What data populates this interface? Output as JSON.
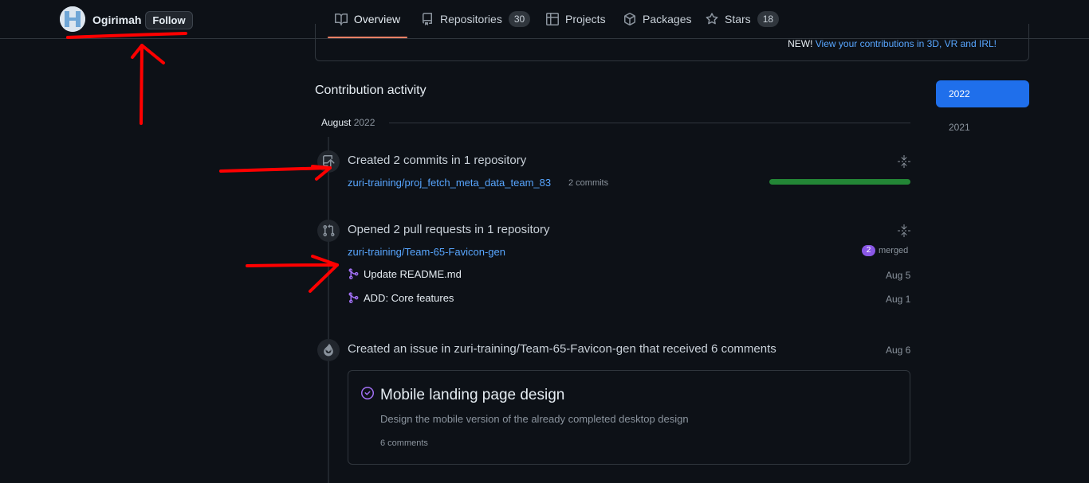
{
  "profile": {
    "username": "Ogirimah",
    "follow_label": "Follow"
  },
  "nav": {
    "tabs": [
      {
        "label": "Overview",
        "icon": "book-icon",
        "active": true
      },
      {
        "label": "Repositories",
        "icon": "repo-icon",
        "count": "30"
      },
      {
        "label": "Projects",
        "icon": "table-icon"
      },
      {
        "label": "Packages",
        "icon": "package-icon"
      },
      {
        "label": "Stars",
        "icon": "star-icon",
        "count": "18"
      }
    ]
  },
  "banner": {
    "new_label": "NEW!",
    "link_text": "View your contributions in 3D, VR and IRL!"
  },
  "activity": {
    "title": "Contribution activity",
    "month": "August",
    "year": "2022"
  },
  "years": {
    "active": "2022",
    "other": "2021"
  },
  "events": {
    "commits": {
      "title": "Created 2 commits in 1 repository",
      "repo": "zuri-training/proj_fetch_meta_data_team_83",
      "count_label": "2 commits",
      "progress": 1.0
    },
    "pulls": {
      "title": "Opened 2 pull requests in 1 repository",
      "repo": "zuri-training/Team-65-Favicon-gen",
      "merged_count": "2",
      "merged_label": "merged",
      "items": [
        {
          "title": "Update README.md",
          "date": "Aug 5"
        },
        {
          "title": "ADD: Core features",
          "date": "Aug 1"
        }
      ]
    },
    "issue": {
      "title": "Created an issue in zuri-training/Team-65-Favicon-gen that received 6 comments",
      "date": "Aug 6",
      "card_title": "Mobile landing page design",
      "card_desc": "Design the mobile version of the already completed desktop design",
      "card_comments": "6 comments"
    }
  },
  "colors": {
    "accent": "#58a6ff",
    "merged": "#8957e5",
    "progress": "#238636",
    "annotation": "#ff0000"
  }
}
